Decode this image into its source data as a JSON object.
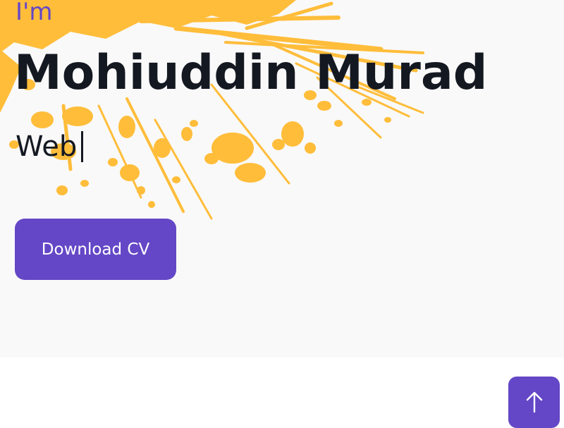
{
  "hero": {
    "intro": "I'm",
    "name": "Mohiuddin Murad",
    "role_typed": "Web",
    "download_label": "Download CV"
  },
  "icons": {
    "scroll_top": "arrow-up-icon",
    "background": "paint-splash"
  },
  "colors": {
    "accent": "#6447c6",
    "text": "#141821",
    "splash": "#ffbd3a",
    "hero_bg": "#f9f9f9",
    "page_bg": "#ffffff"
  }
}
